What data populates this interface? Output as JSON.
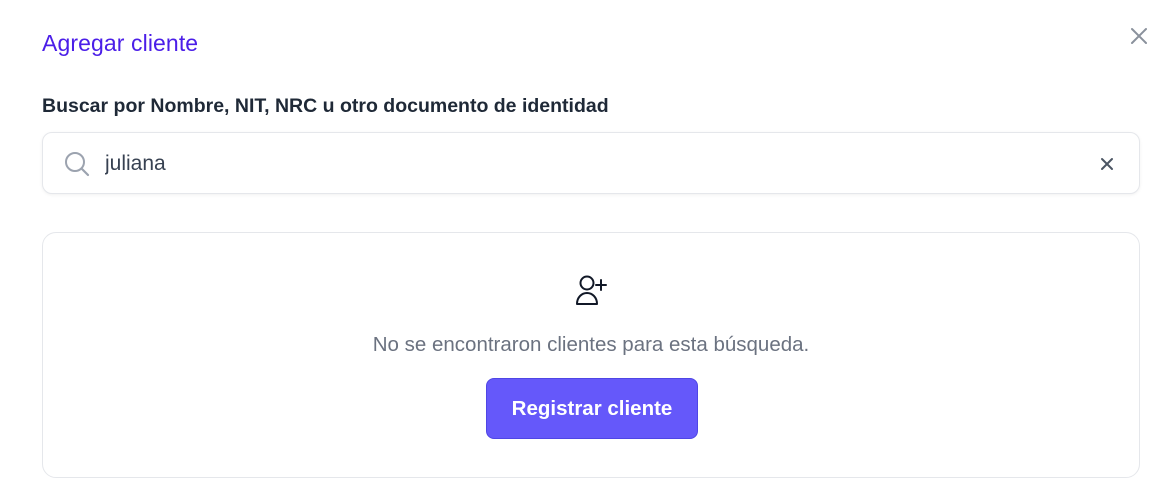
{
  "modal": {
    "title": "Agregar cliente",
    "close_icon": "close-icon"
  },
  "search": {
    "label": "Buscar por Nombre, NIT, NRC u otro documento de identidad",
    "value": "juliana",
    "placeholder": "",
    "search_icon": "search-icon",
    "clear_icon": "clear-icon"
  },
  "empty_state": {
    "icon": "user-plus-icon",
    "message": "No se encontraron clientes para esta búsqueda.",
    "register_button_label": "Registrar cliente"
  },
  "colors": {
    "title": "#4b1ee8",
    "primary_button": "#6558fa",
    "border": "#e5e7eb",
    "muted_text": "#6b7280"
  }
}
